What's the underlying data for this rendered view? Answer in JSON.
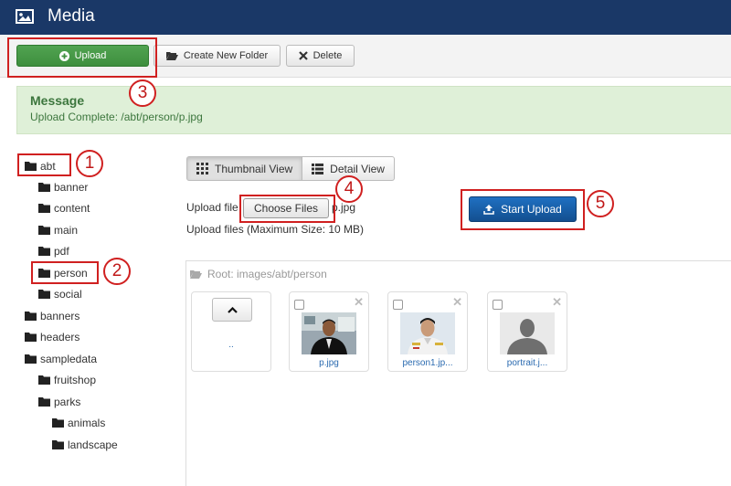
{
  "header": {
    "title": "Media",
    "icon": "image-icon"
  },
  "toolbar": {
    "upload_label": "Upload",
    "create_folder_label": "Create New Folder",
    "delete_label": "Delete"
  },
  "message": {
    "title": "Message",
    "body": "Upload Complete: /abt/person/p.jpg"
  },
  "tree": [
    {
      "label": "abt",
      "level": 0
    },
    {
      "label": "banner",
      "level": 1
    },
    {
      "label": "content",
      "level": 1
    },
    {
      "label": "main",
      "level": 1
    },
    {
      "label": "pdf",
      "level": 1
    },
    {
      "label": "person",
      "level": 1
    },
    {
      "label": "social",
      "level": 1
    },
    {
      "label": "banners",
      "level": 0
    },
    {
      "label": "headers",
      "level": 0
    },
    {
      "label": "sampledata",
      "level": 0
    },
    {
      "label": "fruitshop",
      "level": 1
    },
    {
      "label": "parks",
      "level": 1
    },
    {
      "label": "animals",
      "level": 2
    },
    {
      "label": "landscape",
      "level": 2
    }
  ],
  "views": {
    "thumbnail_label": "Thumbnail View",
    "detail_label": "Detail View"
  },
  "upload_form": {
    "label": "Upload file",
    "choose_label": "Choose Files",
    "chosen_file": "p.jpg",
    "note": "Upload files (Maximum Size: 10 MB)",
    "start_label": "Start Upload"
  },
  "browser": {
    "breadcrumb": "Root: images/abt/person",
    "up_label": "..",
    "files": [
      {
        "name": "p.jpg"
      },
      {
        "name": "person1.jp..."
      },
      {
        "name": "portrait.j..."
      }
    ]
  },
  "annotations": [
    "1",
    "2",
    "3",
    "4",
    "5"
  ],
  "colors": {
    "header": "#1a3867",
    "upload_button": "#4a9c4a",
    "start_button": "#1a5fa8",
    "callout": "#d02020",
    "message_bg": "#dff0d8"
  }
}
